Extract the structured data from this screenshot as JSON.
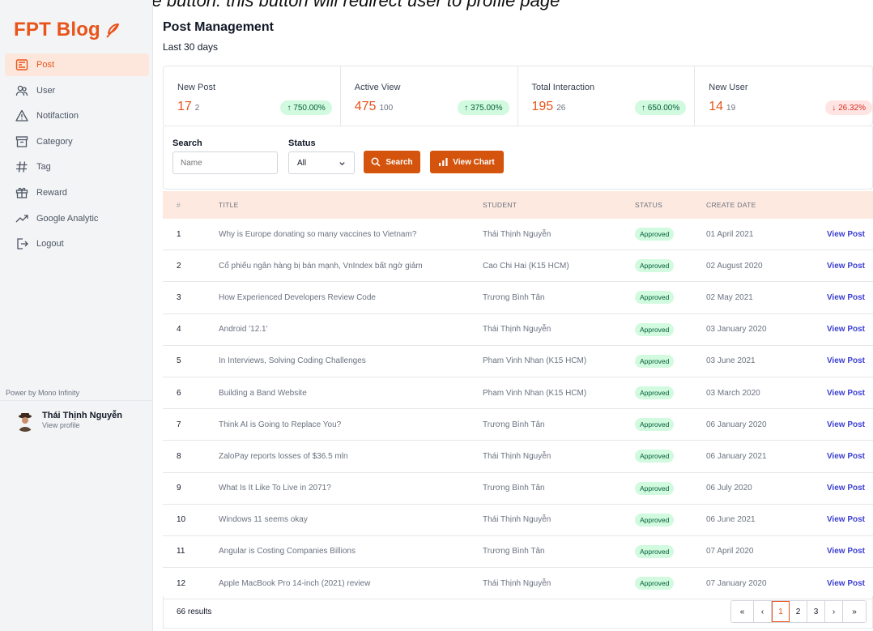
{
  "caption": "View Profile button: this button will redirect user to profile page",
  "brand": {
    "name": "FPT Blog",
    "accent": "#e8541a"
  },
  "sidebar": {
    "items": [
      {
        "label": "Post",
        "icon": "post-icon",
        "active": true
      },
      {
        "label": "User",
        "icon": "users-icon",
        "active": false
      },
      {
        "label": "Notifaction",
        "icon": "warning-icon",
        "active": false
      },
      {
        "label": "Category",
        "icon": "archive-icon",
        "active": false
      },
      {
        "label": "Tag",
        "icon": "hashtag-icon",
        "active": false
      },
      {
        "label": "Reward",
        "icon": "gift-icon",
        "active": false
      },
      {
        "label": "Google Analytic",
        "icon": "trend-icon",
        "active": false
      },
      {
        "label": "Logout",
        "icon": "logout-icon",
        "active": false
      }
    ],
    "power": "Power by Mono Infinity",
    "profile": {
      "name": "Thái Thịnh Nguyễn",
      "link": "View profile"
    }
  },
  "header": {
    "title": "Post Management",
    "subtitle": "Last 30 days"
  },
  "stats": [
    {
      "label": "New Post",
      "value": "17",
      "prev": "2",
      "change": "750.00%",
      "direction": "up"
    },
    {
      "label": "Active View",
      "value": "475",
      "prev": "100",
      "change": "375.00%",
      "direction": "up"
    },
    {
      "label": "Total Interaction",
      "value": "195",
      "prev": "26",
      "change": "650.00%",
      "direction": "up"
    },
    {
      "label": "New User",
      "value": "14",
      "prev": "19",
      "change": "26.32%",
      "direction": "down"
    }
  ],
  "filters": {
    "search_label": "Search",
    "search_placeholder": "Name",
    "status_label": "Status",
    "status_value": "All",
    "search_button": "Search",
    "chart_button": "View Chart"
  },
  "table": {
    "headers": {
      "idx": "#",
      "title": "TITLE",
      "student": "STUDENT",
      "status": "STATUS",
      "date": "CREATE DATE"
    },
    "view_label": "View Post",
    "rows": [
      {
        "idx": "1",
        "title": "Why is Europe donating so many vaccines to Vietnam?",
        "student": "Thái Thịnh Nguyễn",
        "status": "Approved",
        "date": "01 April 2021"
      },
      {
        "idx": "2",
        "title": "Cổ phiếu ngân hàng bị bán mạnh, VnIndex bất ngờ giảm",
        "student": "Cao Chi Hai (K15 HCM)",
        "status": "Approved",
        "date": "02 August 2020"
      },
      {
        "idx": "3",
        "title": "How Experienced Developers Review Code",
        "student": "Trương Bình Tân",
        "status": "Approved",
        "date": "02 May 2021"
      },
      {
        "idx": "4",
        "title": "Android '12.1'",
        "student": "Thái Thịnh Nguyễn",
        "status": "Approved",
        "date": "03 January 2020"
      },
      {
        "idx": "5",
        "title": "In Interviews, Solving Coding Challenges",
        "student": "Pham Vinh Nhan (K15 HCM)",
        "status": "Approved",
        "date": "03 June 2021"
      },
      {
        "idx": "6",
        "title": "Building a Band Website",
        "student": "Pham Vinh Nhan (K15 HCM)",
        "status": "Approved",
        "date": "03 March 2020"
      },
      {
        "idx": "7",
        "title": "Think AI is Going to Replace You?",
        "student": "Trương Bình Tân",
        "status": "Approved",
        "date": "06 January 2020"
      },
      {
        "idx": "8",
        "title": "ZaloPay reports losses of $36.5 mln",
        "student": "Thái Thịnh Nguyễn",
        "status": "Approved",
        "date": "06 January 2021"
      },
      {
        "idx": "9",
        "title": "What Is It Like To Live in 2071?",
        "student": "Trương Bình Tân",
        "status": "Approved",
        "date": "06 July 2020"
      },
      {
        "idx": "10",
        "title": "Windows 11 seems okay",
        "student": "Thái Thịnh Nguyễn",
        "status": "Approved",
        "date": "06 June 2021"
      },
      {
        "idx": "11",
        "title": "Angular is Costing Companies Billions",
        "student": "Trương Bình Tân",
        "status": "Approved",
        "date": "07 April 2020"
      },
      {
        "idx": "12",
        "title": "Apple MacBook Pro 14-inch (2021) review",
        "student": "Thái Thịnh Nguyễn",
        "status": "Approved",
        "date": "07 January 2020"
      }
    ]
  },
  "footer": {
    "results": "66 results",
    "pages": [
      "«",
      "‹",
      "1",
      "2",
      "3",
      "›",
      "»"
    ],
    "active_page": "1"
  }
}
